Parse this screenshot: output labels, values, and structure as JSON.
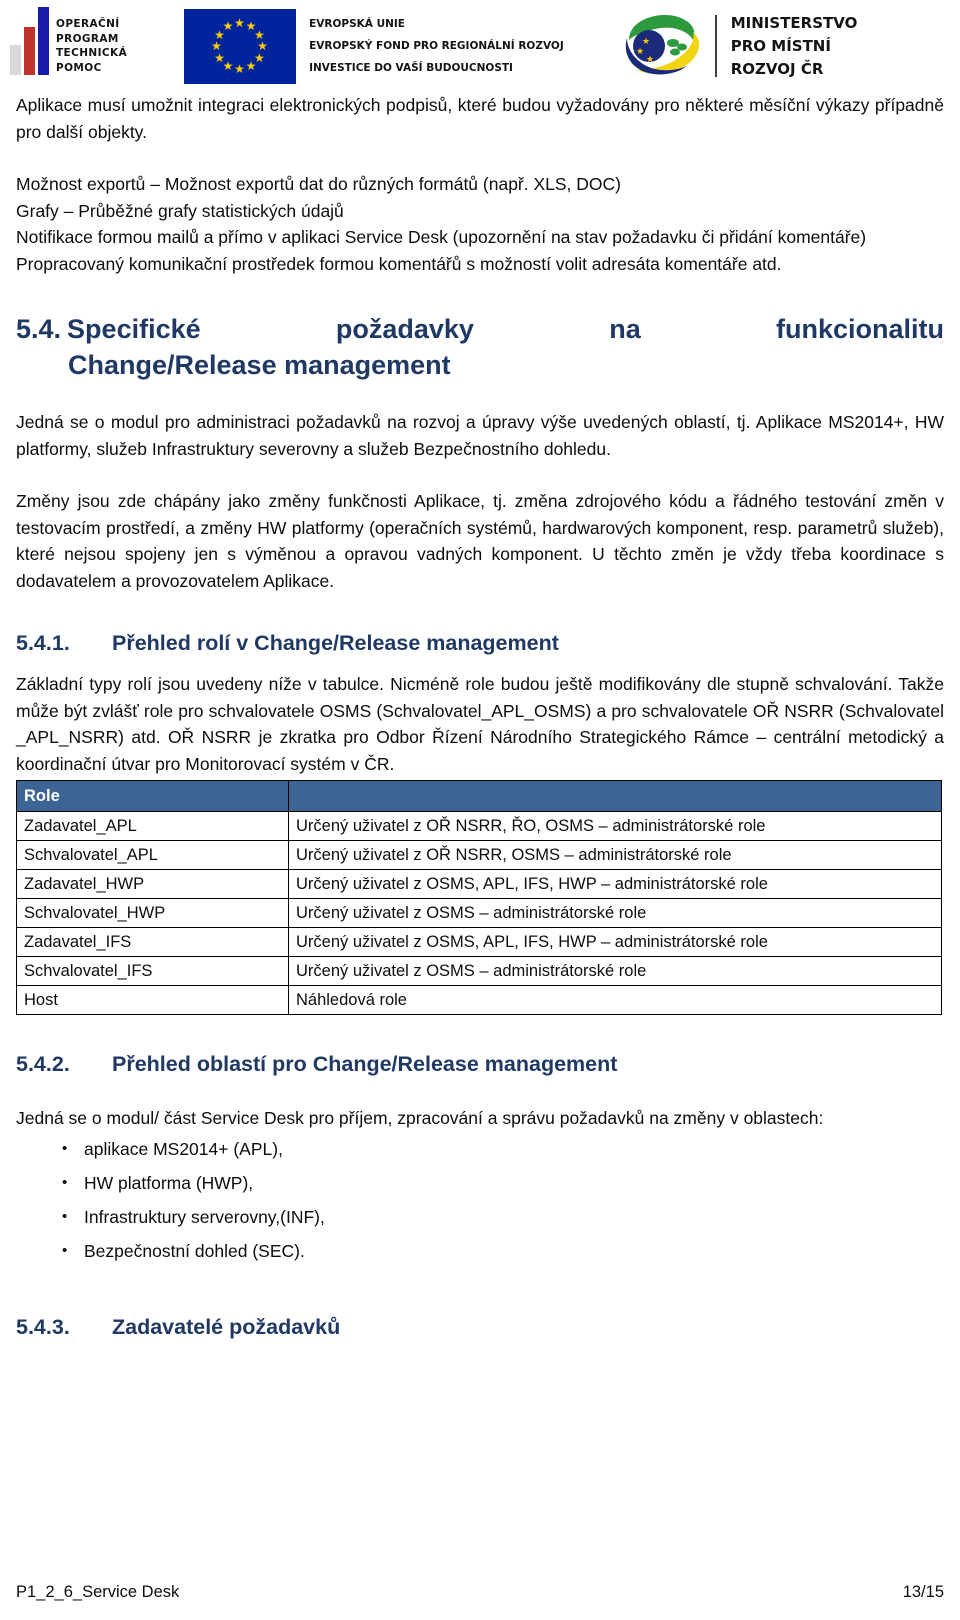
{
  "header": {
    "optp_logo": {
      "name": "operacni-program-technicka-pomoc-logo",
      "lines": [
        "OPERAČNÍ",
        "PROGRAM",
        "TECHNICKÁ",
        "POMOC"
      ]
    },
    "eu_logo": {
      "name": "european-union-flag",
      "lines": [
        "EVROPSKÁ UNIE",
        "EVROPSKÝ FOND PRO REGIONÁLNÍ ROZVOJ",
        "INVESTICE DO VAŠÍ BUDOUCNOSTI"
      ]
    },
    "ministry_logo": {
      "name": "ministerstvo-pro-mistni-rozvoj-cr-logo",
      "lines": [
        "MINISTERSTVO",
        "PRO MÍSTNÍ",
        "ROZVOJ ČR"
      ]
    }
  },
  "body": {
    "para_1": "Aplikace musí umožnit integraci elektronických podpisů, které budou vyžadovány pro některé měsíční výkazy případně pro další objekty.",
    "line_export": "Možnost exportů – Možnost exportů dat do různých formátů (např. XLS, DOC)",
    "line_grafy": "Grafy – Průběžné grafy statistických údajů",
    "line_notifikace": "Notifikace formou mailů a přímo v aplikaci Service Desk (upozornění na stav požadavku či přidání komentáře)",
    "line_komunikace": "Propracovaný komunikační prostředek formou komentářů s možností volit adresáta komentáře atd.",
    "para_modul": "Jedná se o modul pro administraci požadavků na rozvoj a úpravy výše uvedených oblastí, tj. Aplikace MS2014+, HW platformy, služeb Infrastruktury severovny  a služeb Bezpečnostního dohledu.",
    "para_zmeny": "Změny jsou zde chápány jako změny funkčnosti Aplikace, tj. změna zdrojového kódu a řádného testování změn v testovacím prostředí, a změny HW platformy (operačních systémů, hardwarových komponent, resp. parametrů služeb), které nejsou spojeny jen s výměnou a opravou vadných komponent. U těchto změn je vždy třeba koordinace s dodavatelem a provozovatelem Aplikace.",
    "para_role": "Základní typy rolí jsou uvedeny níže v tabulce. Nicméně role budou ještě modifikovány dle stupně schvalování. Takže může být zvlášť role pro schvalovatele OSMS (Schvalovatel_APL_OSMS) a pro schvalovatele OŘ NSRR (Schvalovatel _APL_NSRR) atd. OŘ NSRR je zkratka pro Odbor Řízení Národního Strategického Rámce – centrální metodický a koordinační útvar pro Monitorovací systém v ČR.",
    "para_oblasti": "Jedná se o modul/ část Service Desk pro příjem, zpracování a správu požadavků na změny v oblastech:"
  },
  "headings": {
    "h54_num": "5.4.",
    "h54_line1": "Specifické požadavky na funkcionalitu",
    "h54_line2": "Change/Release management",
    "h541_num": "5.4.1.",
    "h541_title": "Přehled rolí v Change/Release management",
    "h542_num": "5.4.2.",
    "h542_title": "Přehled oblastí pro Change/Release management",
    "h543_num": "5.4.3.",
    "h543_title": "Zadavatelé požadavků"
  },
  "roles_table": {
    "header": [
      "Role",
      ""
    ],
    "rows": [
      [
        "Zadavatel_APL",
        "Určený uživatel z OŘ NSRR, ŘO, OSMS – administrátorské role"
      ],
      [
        "Schvalovatel_APL",
        "Určený uživatel z OŘ NSRR, OSMS – administrátorské role"
      ],
      [
        "Zadavatel_HWP",
        "Určený uživatel z OSMS, APL, IFS, HWP – administrátorské role"
      ],
      [
        "Schvalovatel_HWP",
        "Určený uživatel z OSMS – administrátorské role"
      ],
      [
        "Zadavatel_IFS",
        "Určený uživatel z OSMS, APL, IFS, HWP – administrátorské role"
      ],
      [
        "Schvalovatel_IFS",
        "Určený uživatel z OSMS – administrátorské role"
      ],
      [
        "Host",
        "Náhledová role"
      ]
    ]
  },
  "areas": [
    " aplikace MS2014+ (APL),",
    "HW platforma (HWP),",
    "Infrastruktury serverovny,(INF),",
    "Bezpečnostní dohled (SEC)."
  ],
  "footer": {
    "document_name": "P1_2_6_Service Desk",
    "page_number": "13/15"
  },
  "colors": {
    "heading_blue": "#1F3864",
    "table_header_blue": "#3C6595",
    "eu_blue": "#00249C",
    "eu_star_yellow": "#FFCC00",
    "optp_red": "#C0332A",
    "optp_blue": "#1A1AA8"
  }
}
